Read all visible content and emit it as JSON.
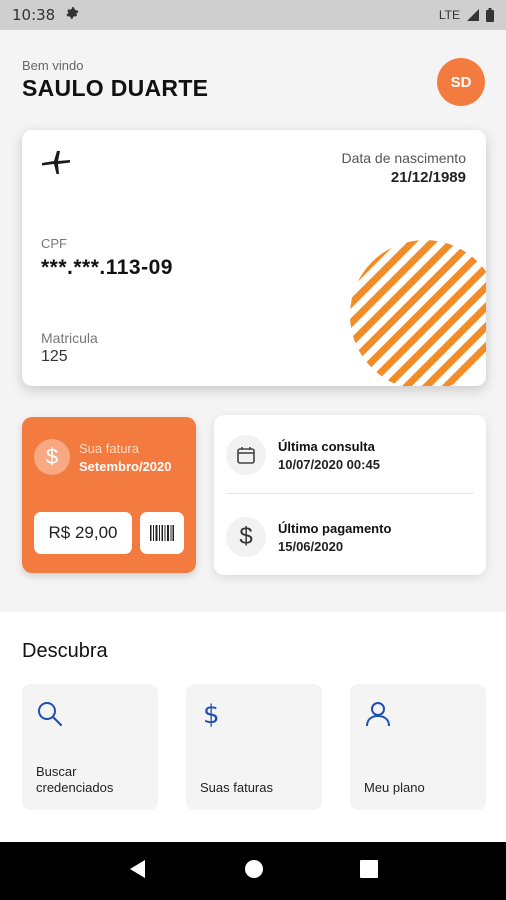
{
  "status_bar": {
    "time": "10:38",
    "network": "LTE"
  },
  "header": {
    "welcome": "Bem vindo",
    "user_name": "SAULO DUARTE",
    "avatar_initials": "SD"
  },
  "card": {
    "dob_label": "Data de nascimento",
    "dob_value": "21/12/1989",
    "cpf_label": "CPF",
    "cpf_value": "***.***.113-09",
    "matricula_label": "Matricula",
    "matricula_value": "125"
  },
  "invoice": {
    "label": "Sua fatura",
    "month": "Setembro/2020",
    "amount": "R$ 29,00"
  },
  "info": {
    "last_consult_label": "Última consulta",
    "last_consult_value": "10/07/2020 00:45",
    "last_payment_label": "Último pagamento",
    "last_payment_value": "15/06/2020"
  },
  "discover": {
    "title": "Descubra",
    "tiles": [
      {
        "label": "Buscar credenciados",
        "icon": "search-icon"
      },
      {
        "label": "Suas faturas",
        "icon": "dollar-icon"
      },
      {
        "label": "Meu plano",
        "icon": "person-icon"
      }
    ]
  },
  "colors": {
    "accent": "#f47b3f",
    "blue_icon": "#1f4fb5",
    "stripes": "#f28c28"
  },
  "icons": {
    "settings": "gear-icon",
    "nav_back": "back-triangle-icon",
    "nav_home": "home-circle-icon",
    "nav_recent": "recent-square-icon"
  }
}
